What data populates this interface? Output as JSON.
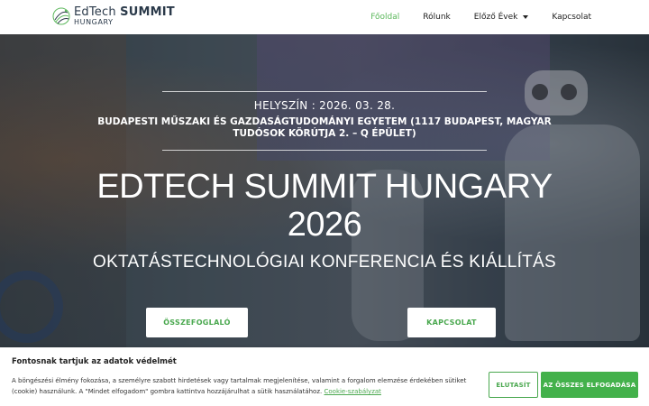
{
  "header": {
    "logo": {
      "line1_a": "EdTech",
      "line1_b": "SUMMIT",
      "line2": "HUNGARY"
    },
    "nav": [
      {
        "label": "Főoldal",
        "active": true
      },
      {
        "label": "Rólunk"
      },
      {
        "label": "Előző Évek",
        "has_dropdown": true
      },
      {
        "label": "Kapcsolat"
      }
    ]
  },
  "hero": {
    "location": "HELYSZÍN : 2026. 03. 28.",
    "venue": "BUDAPESTI MŰSZAKI ÉS GAZDASÁGTUDOMÁNYI EGYETEM (1117 BUDAPEST, MAGYAR TUDÓSOK KÖRÚTJA 2. – Q ÉPÜLET)",
    "title_line1": "EDTECH SUMMIT HUNGARY",
    "title_line2": "2026",
    "subtitle": "OKTATÁSTECHNOLÓGIAI KONFERENCIA ÉS KIÁLLÍTÁS",
    "btn_summary": "ÖSSZEFOGLALÓ",
    "btn_contact": "KAPCSOLAT"
  },
  "cookie": {
    "title": "Fontosnak tartjuk az adatok védelmét",
    "text": "A böngészési élmény fokozása, a személyre szabott hirdetések vagy tartalmak megjelenítése, valamint a forgalom elemzése érdekében sütiket (cookie) használunk. A \"Mindet elfogadom\" gombra kattintva hozzájárulhat a sütik használatához.",
    "link": "Cookie-szabályzat",
    "reject": "ELUTASÍT",
    "accept": "AZ ÖSSZES ELFOGADÁSA"
  },
  "colors": {
    "accent": "#4aa84f",
    "accept_bg": "#43b14b",
    "text_dark": "#222222"
  }
}
